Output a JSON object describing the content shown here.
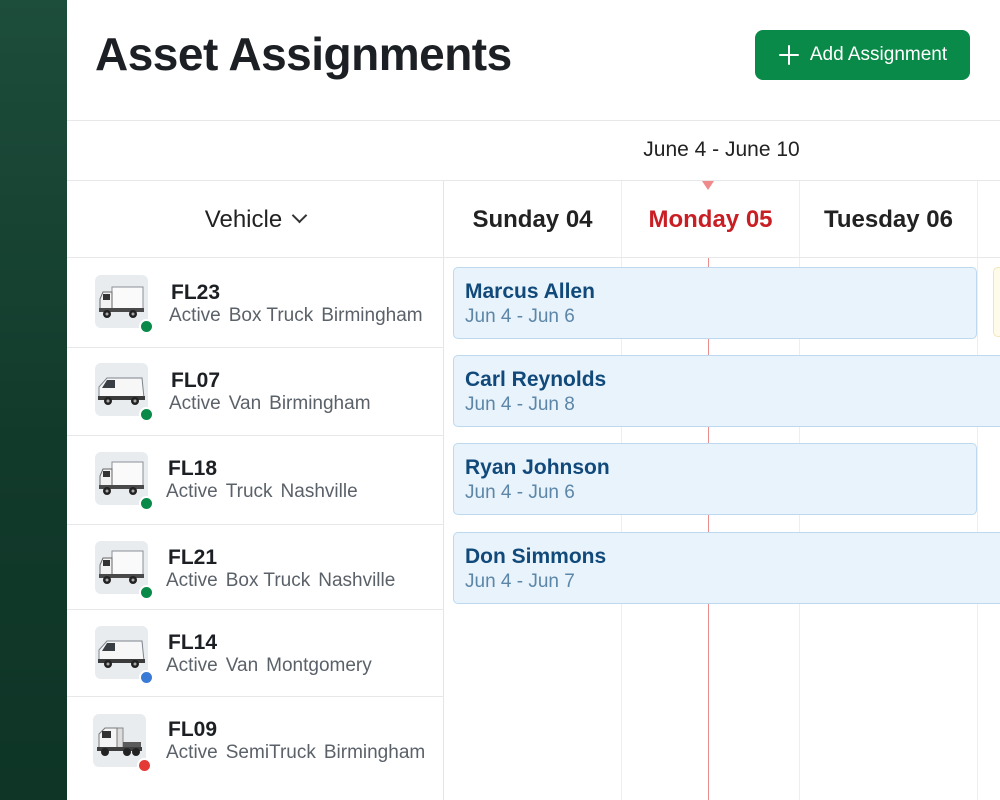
{
  "page": {
    "title": "Asset Assignments"
  },
  "toolbar": {
    "add_label": "Add Assignment",
    "add_icon": "plus-icon"
  },
  "calendar": {
    "week_range": "June 4 - June 10",
    "vehicle_column_label": "Vehicle",
    "days": [
      {
        "label": "Sunday 04",
        "today": false
      },
      {
        "label": "Monday 05",
        "today": true
      },
      {
        "label": "Tuesday 06",
        "today": false
      }
    ]
  },
  "vehicles": [
    {
      "id": "FL23",
      "status": "Active",
      "type": "Box Truck",
      "location": "Birmingham",
      "status_color": "#0a8a48",
      "icon": "box-truck-icon"
    },
    {
      "id": "FL07",
      "status": "Active",
      "type": "Van",
      "location": "Birmingham",
      "status_color": "#0a8a48",
      "icon": "van-icon"
    },
    {
      "id": "FL18",
      "status": "Active",
      "type": "Truck",
      "location": "Nashville",
      "status_color": "#0a8a48",
      "icon": "box-truck-icon"
    },
    {
      "id": "FL21",
      "status": "Active",
      "type": "Box Truck",
      "location": "Nashville",
      "status_color": "#0a8a48",
      "icon": "box-truck-icon"
    },
    {
      "id": "FL14",
      "status": "Active",
      "type": "Van",
      "location": "Montgomery",
      "status_color": "#3a7bd5",
      "icon": "van-icon"
    },
    {
      "id": "FL09",
      "status": "Active",
      "type": "SemiTruck",
      "location": "Birmingham",
      "status_color": "#e53935",
      "icon": "semi-truck-icon"
    }
  ],
  "assignments": [
    {
      "name": "Marcus Allen",
      "range": "Jun 4 - Jun 6"
    },
    {
      "name": "Carl Reynolds",
      "range": "Jun 4 - Jun 8"
    },
    {
      "name": "Ryan Johnson",
      "range": "Jun 4 - Jun 6"
    },
    {
      "name": "Don Simmons",
      "range": "Jun 4 - Jun 7"
    }
  ],
  "colors": {
    "accent": "#0a8a48",
    "today": "#c81e24",
    "bar_fill": "#e8f3fc",
    "bar_text": "#114a7a"
  }
}
